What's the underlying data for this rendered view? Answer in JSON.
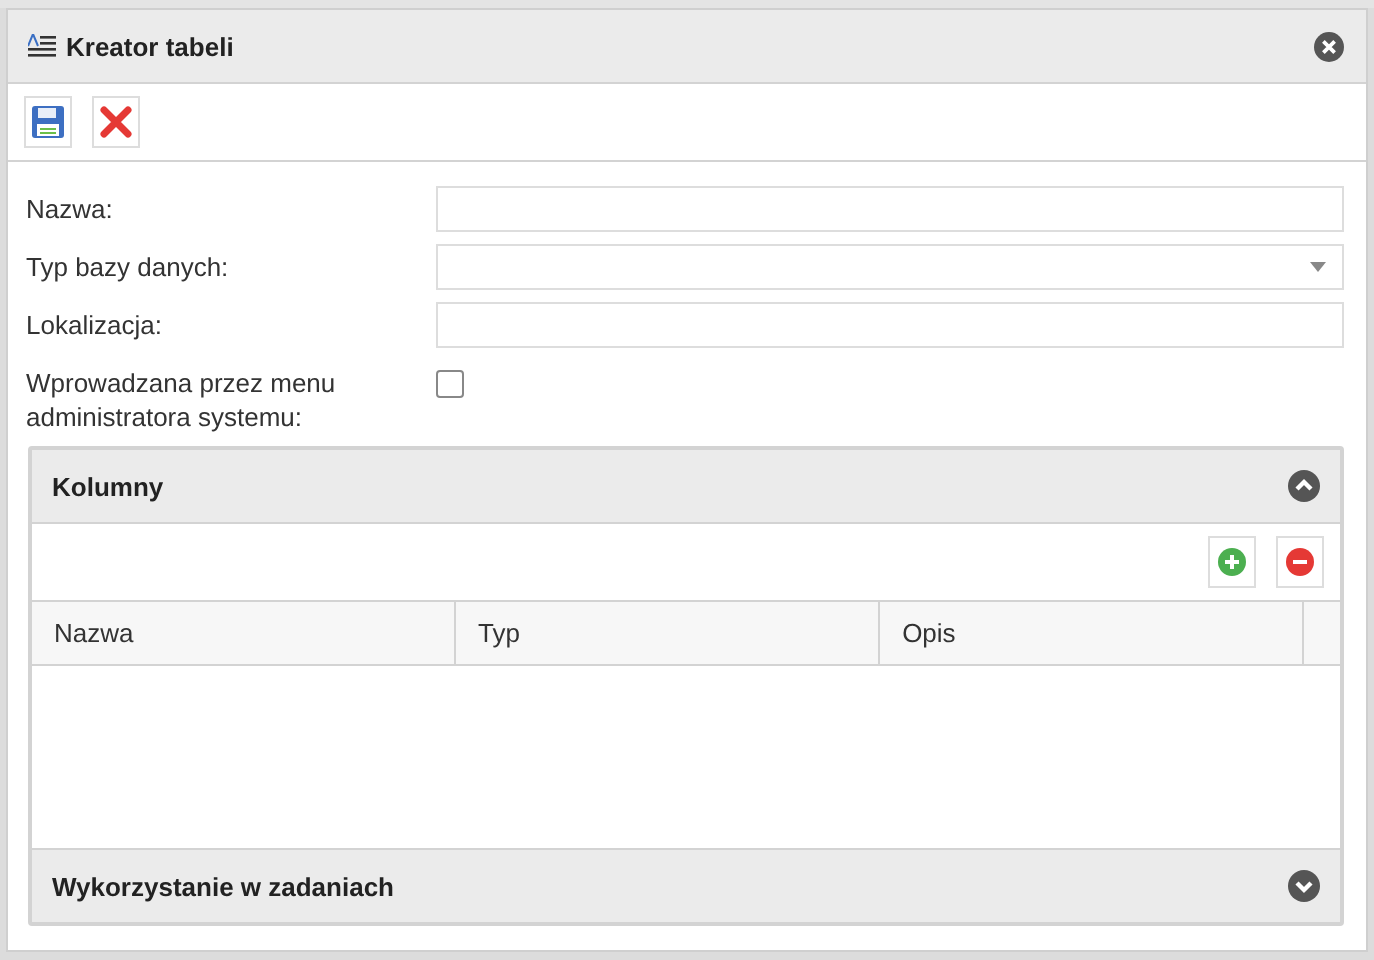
{
  "window": {
    "title": "Kreator tabeli"
  },
  "form": {
    "fields": [
      {
        "kind": "text",
        "label": "Nazwa:"
      },
      {
        "kind": "select",
        "label": "Typ bazy danych:"
      },
      {
        "kind": "text",
        "label": "Lokalizacja:"
      },
      {
        "kind": "checkbox",
        "label": "Wprowadzana przez menu administratora systemu:",
        "checked": false
      }
    ]
  },
  "sections": [
    {
      "title": "Kolumny",
      "expanded": true,
      "table": {
        "columns": [
          "Nazwa",
          "Typ",
          "Opis"
        ]
      }
    },
    {
      "title": "Wykorzystanie w zadaniach",
      "expanded": false
    }
  ]
}
